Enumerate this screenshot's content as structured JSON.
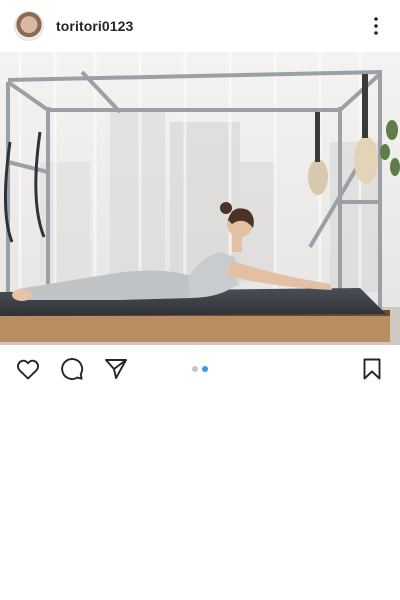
{
  "post": {
    "username": "toritori0123",
    "carousel": {
      "total": 2,
      "active": 2
    }
  },
  "icons": {
    "more": "more-vertical-icon",
    "like": "heart-icon",
    "comment": "comment-icon",
    "share": "send-icon",
    "save": "bookmark-icon"
  },
  "colors": {
    "text": "#262626",
    "active_dot": "#3897f0",
    "inactive_dot": "#c7c7c7"
  }
}
